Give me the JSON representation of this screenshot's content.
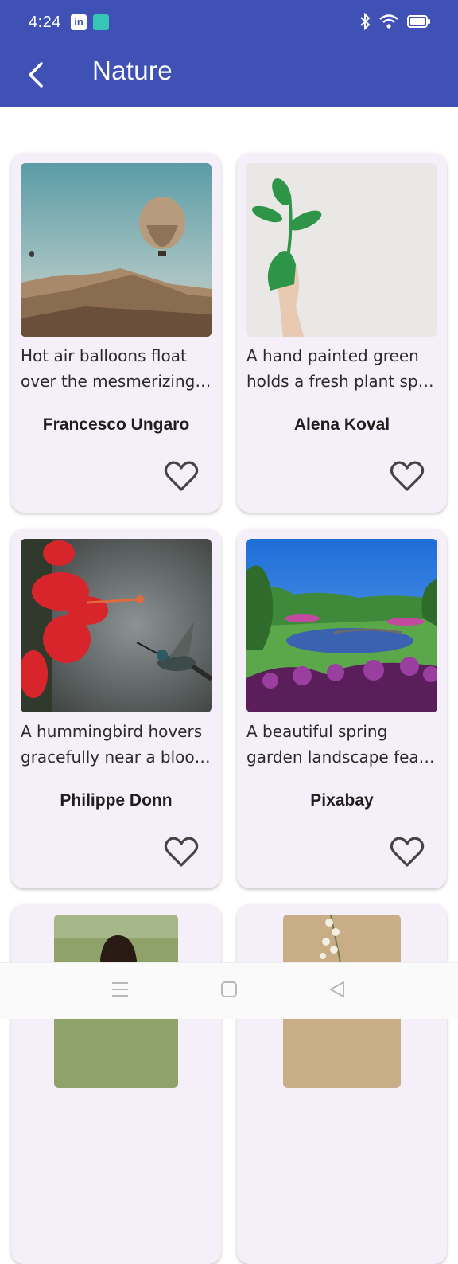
{
  "status": {
    "time": "4:24",
    "icons": [
      "linkedin-icon",
      "app-icon",
      "bluetooth-icon",
      "wifi-icon",
      "battery-icon"
    ]
  },
  "appbar": {
    "title": "Nature",
    "back_icon": "arrow-back-icon"
  },
  "cards": [
    {
      "desc1": "Hot air balloons float",
      "desc2": "over the mesmerizing…",
      "author": "Francesco Ungaro"
    },
    {
      "desc1": "A hand painted green",
      "desc2": "holds a fresh plant sp…",
      "author": "Alena Koval"
    },
    {
      "desc1": "A hummingbird hovers",
      "desc2": "gracefully near a bloo…",
      "author": "Philippe Donn"
    },
    {
      "desc1": "A beautiful spring",
      "desc2": "garden landscape fea…",
      "author": "Pixabay"
    },
    {
      "desc1": "",
      "desc2": "",
      "author": ""
    },
    {
      "desc1": "",
      "desc2": "",
      "author": ""
    }
  ],
  "colors": {
    "primary": "#3f51b5",
    "card_bg": "#f4eff8"
  },
  "navbar": {
    "icons": [
      "menu-icon",
      "home-square-icon",
      "back-triangle-icon"
    ]
  }
}
